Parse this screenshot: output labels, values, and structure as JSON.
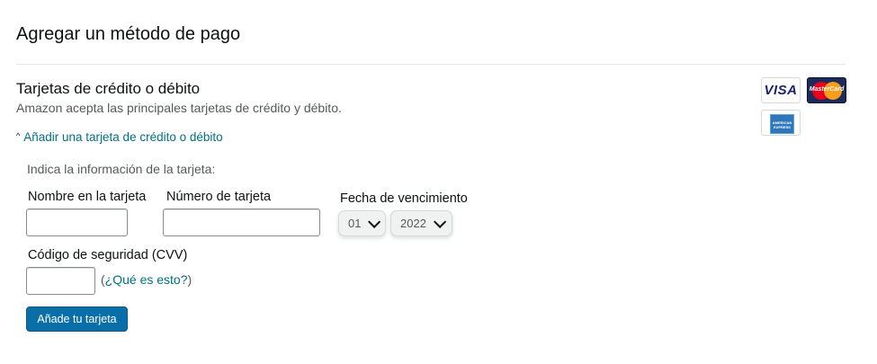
{
  "page": {
    "title": "Agregar un método de pago"
  },
  "section": {
    "title": "Tarjetas de crédito o débito",
    "subtitle": "Amazon acepta las principales tarjetas de crédito y débito.",
    "toggle_label": "Añadir una tarjeta de crédito o débito"
  },
  "card_logos": [
    {
      "name": "visa-logo",
      "text": "VISA"
    },
    {
      "name": "mastercard-logo",
      "text": "MasterCard"
    },
    {
      "name": "amex-logo",
      "text": "AMERICAN EXPRESS"
    }
  ],
  "form": {
    "prompt": "Indica la información de la tarjeta:",
    "name_label": "Nombre en la tarjeta",
    "name_value": "",
    "number_label": "Número de tarjeta",
    "number_value": "",
    "expiry_label": "Fecha de vencimiento",
    "expiry_month": "01",
    "expiry_year": "2022",
    "cvv_label": "Código de seguridad (CVV)",
    "cvv_value": "",
    "cvv_help_open": "(",
    "cvv_help_link": "¿Qué es esto?",
    "cvv_help_close": ")",
    "submit_label": "Añade tu tarjeta"
  },
  "colors": {
    "link": "#007185",
    "button": "#0a6fa8"
  }
}
